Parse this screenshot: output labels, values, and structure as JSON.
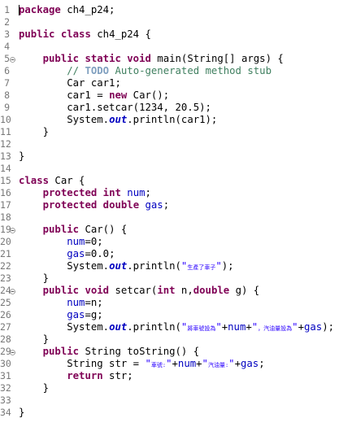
{
  "editor": {
    "lines": [
      {
        "n": "1",
        "fold": false,
        "tokens": [
          [
            "kw",
            "package"
          ],
          [
            "pl",
            " ch4_p24;"
          ]
        ]
      },
      {
        "n": "2",
        "fold": false,
        "tokens": []
      },
      {
        "n": "3",
        "fold": false,
        "tokens": [
          [
            "kw",
            "public"
          ],
          [
            "pl",
            " "
          ],
          [
            "kw",
            "class"
          ],
          [
            "pl",
            " ch4_p24 {"
          ]
        ]
      },
      {
        "n": "4",
        "fold": false,
        "tokens": []
      },
      {
        "n": "5",
        "fold": true,
        "tokens": [
          [
            "pl",
            "    "
          ],
          [
            "kw",
            "public"
          ],
          [
            "pl",
            " "
          ],
          [
            "kw",
            "static"
          ],
          [
            "pl",
            " "
          ],
          [
            "kw",
            "void"
          ],
          [
            "pl",
            " main(String[] args) {"
          ]
        ]
      },
      {
        "n": "6",
        "fold": false,
        "tokens": [
          [
            "pl",
            "        "
          ],
          [
            "cm",
            "// "
          ],
          [
            "todo",
            "TODO"
          ],
          [
            "cm",
            " Auto-generated method stub"
          ]
        ]
      },
      {
        "n": "7",
        "fold": false,
        "tokens": [
          [
            "pl",
            "        Car car1;"
          ]
        ]
      },
      {
        "n": "8",
        "fold": false,
        "tokens": [
          [
            "pl",
            "        car1 = "
          ],
          [
            "kw",
            "new"
          ],
          [
            "pl",
            " Car();"
          ]
        ]
      },
      {
        "n": "9",
        "fold": false,
        "tokens": [
          [
            "pl",
            "        car1.setcar(1234, 20.5);"
          ]
        ]
      },
      {
        "n": "10",
        "fold": false,
        "tokens": [
          [
            "pl",
            "        System."
          ],
          [
            "st",
            "out"
          ],
          [
            "pl",
            ".println(car1);"
          ]
        ]
      },
      {
        "n": "11",
        "fold": false,
        "tokens": [
          [
            "pl",
            "    }"
          ]
        ]
      },
      {
        "n": "12",
        "fold": false,
        "tokens": []
      },
      {
        "n": "13",
        "fold": false,
        "tokens": [
          [
            "pl",
            "}"
          ]
        ]
      },
      {
        "n": "14",
        "fold": false,
        "tokens": []
      },
      {
        "n": "15",
        "fold": false,
        "tokens": [
          [
            "kw",
            "class"
          ],
          [
            "pl",
            " Car {"
          ]
        ]
      },
      {
        "n": "16",
        "fold": false,
        "tokens": [
          [
            "pl",
            "    "
          ],
          [
            "kw",
            "protected"
          ],
          [
            "pl",
            " "
          ],
          [
            "kw",
            "int"
          ],
          [
            "pl",
            " "
          ],
          [
            "fld",
            "num"
          ],
          [
            "pl",
            ";"
          ]
        ]
      },
      {
        "n": "17",
        "fold": false,
        "tokens": [
          [
            "pl",
            "    "
          ],
          [
            "kw",
            "protected"
          ],
          [
            "pl",
            " "
          ],
          [
            "kw",
            "double"
          ],
          [
            "pl",
            " "
          ],
          [
            "fld",
            "gas"
          ],
          [
            "pl",
            ";"
          ]
        ]
      },
      {
        "n": "18",
        "fold": false,
        "tokens": []
      },
      {
        "n": "19",
        "fold": true,
        "tokens": [
          [
            "pl",
            "    "
          ],
          [
            "kw",
            "public"
          ],
          [
            "pl",
            " Car() {"
          ]
        ]
      },
      {
        "n": "20",
        "fold": false,
        "tokens": [
          [
            "pl",
            "        "
          ],
          [
            "fld",
            "num"
          ],
          [
            "pl",
            "=0;"
          ]
        ]
      },
      {
        "n": "21",
        "fold": false,
        "tokens": [
          [
            "pl",
            "        "
          ],
          [
            "fld",
            "gas"
          ],
          [
            "pl",
            "=0.0;"
          ]
        ]
      },
      {
        "n": "22",
        "fold": false,
        "tokens": [
          [
            "pl",
            "        System."
          ],
          [
            "st",
            "out"
          ],
          [
            "pl",
            ".println("
          ],
          [
            "str",
            "\""
          ],
          [
            "cjk",
            "生產了車子"
          ],
          [
            "str",
            "\""
          ],
          [
            "pl",
            ");"
          ]
        ]
      },
      {
        "n": "23",
        "fold": false,
        "tokens": [
          [
            "pl",
            "    }"
          ]
        ]
      },
      {
        "n": "24",
        "fold": true,
        "tokens": [
          [
            "pl",
            "    "
          ],
          [
            "kw",
            "public"
          ],
          [
            "pl",
            " "
          ],
          [
            "kw",
            "void"
          ],
          [
            "pl",
            " setcar("
          ],
          [
            "kw",
            "int"
          ],
          [
            "pl",
            " n,"
          ],
          [
            "kw",
            "double"
          ],
          [
            "pl",
            " g) {"
          ]
        ]
      },
      {
        "n": "25",
        "fold": false,
        "tokens": [
          [
            "pl",
            "        "
          ],
          [
            "fld",
            "num"
          ],
          [
            "pl",
            "=n;"
          ]
        ]
      },
      {
        "n": "26",
        "fold": false,
        "tokens": [
          [
            "pl",
            "        "
          ],
          [
            "fld",
            "gas"
          ],
          [
            "pl",
            "=g;"
          ]
        ]
      },
      {
        "n": "27",
        "fold": false,
        "tokens": [
          [
            "pl",
            "        System."
          ],
          [
            "st",
            "out"
          ],
          [
            "pl",
            ".println("
          ],
          [
            "str",
            "\""
          ],
          [
            "cjk",
            "將車號設為"
          ],
          [
            "str",
            "\""
          ],
          [
            "pl",
            "+"
          ],
          [
            "fld",
            "num"
          ],
          [
            "pl",
            "+"
          ],
          [
            "str",
            "\""
          ],
          [
            "cjk",
            "，汽油量設為"
          ],
          [
            "str",
            "\""
          ],
          [
            "pl",
            "+"
          ],
          [
            "fld",
            "gas"
          ],
          [
            "pl",
            ");"
          ]
        ]
      },
      {
        "n": "28",
        "fold": false,
        "tokens": [
          [
            "pl",
            "    }"
          ]
        ]
      },
      {
        "n": "29",
        "fold": true,
        "tokens": [
          [
            "pl",
            "    "
          ],
          [
            "kw",
            "public"
          ],
          [
            "pl",
            " String toString() {"
          ]
        ]
      },
      {
        "n": "30",
        "fold": false,
        "tokens": [
          [
            "pl",
            "        String str = "
          ],
          [
            "str",
            "\""
          ],
          [
            "cjk",
            "車號:"
          ],
          [
            "str",
            "\""
          ],
          [
            "pl",
            "+"
          ],
          [
            "fld",
            "num"
          ],
          [
            "pl",
            "+"
          ],
          [
            "str",
            "\""
          ],
          [
            "cjk",
            "汽油量:"
          ],
          [
            "str",
            "\""
          ],
          [
            "pl",
            "+"
          ],
          [
            "fld",
            "gas"
          ],
          [
            "pl",
            ";"
          ]
        ]
      },
      {
        "n": "31",
        "fold": false,
        "tokens": [
          [
            "pl",
            "        "
          ],
          [
            "kw",
            "return"
          ],
          [
            "pl",
            " str;"
          ]
        ]
      },
      {
        "n": "32",
        "fold": false,
        "tokens": [
          [
            "pl",
            "    }"
          ]
        ]
      },
      {
        "n": "33",
        "fold": false,
        "tokens": []
      },
      {
        "n": "34",
        "fold": false,
        "tokens": [
          [
            "pl",
            "}"
          ]
        ]
      }
    ],
    "colors": {
      "keyword": "#7f0055",
      "comment": "#3f7f5f",
      "field": "#0000c0",
      "string": "#2a00ff",
      "line_number": "#787878"
    },
    "icons": {
      "fold": "fold-collapse-icon"
    }
  }
}
